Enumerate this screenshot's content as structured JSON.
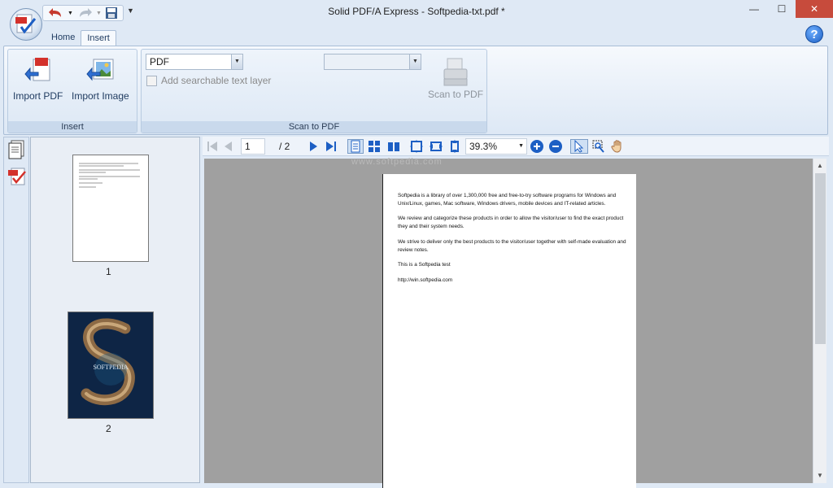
{
  "window": {
    "title": "Solid PDF/A Express - Softpedia-txt.pdf *"
  },
  "tabs": [
    {
      "label": "Home"
    },
    {
      "label": "Insert"
    }
  ],
  "ribbon": {
    "insert_group": {
      "label": "Insert",
      "import_pdf": "Import PDF",
      "import_image": "Import Image"
    },
    "scan_group": {
      "label": "Scan to PDF",
      "format_value": "PDF",
      "scanner_value": "",
      "searchable_label": "Add searchable text layer",
      "scan_button": "Scan to PDF"
    }
  },
  "thumbnails": [
    {
      "label": "1"
    },
    {
      "label": "2"
    }
  ],
  "thumb2_title": "SOFTPEDIA",
  "navigation": {
    "current_page": "1",
    "total_pages": "/ 2",
    "zoom": "39.3%"
  },
  "watermark": "www.softpedia.com",
  "document": {
    "paragraphs": [
      "Softpedia is a library of over 1,300,000 free and free-to-try software programs for Windows and Unix/Linux, games, Mac software, Windows drivers, mobile devices and IT-related articles.",
      "We review and categorize these products in order to allow the visitor/user to find the exact product they and their system needs.",
      "We strive to deliver only the best products to the visitor/user together with self-made evaluation and review notes.",
      "This is a Softpedia test",
      "http://win.softpedia.com"
    ]
  },
  "colors": {
    "ribbon_bg": "#dde8f5",
    "accent_blue": "#1d5fc4",
    "close_red": "#c74b3c",
    "viewer_bg": "#a0a0a0"
  }
}
